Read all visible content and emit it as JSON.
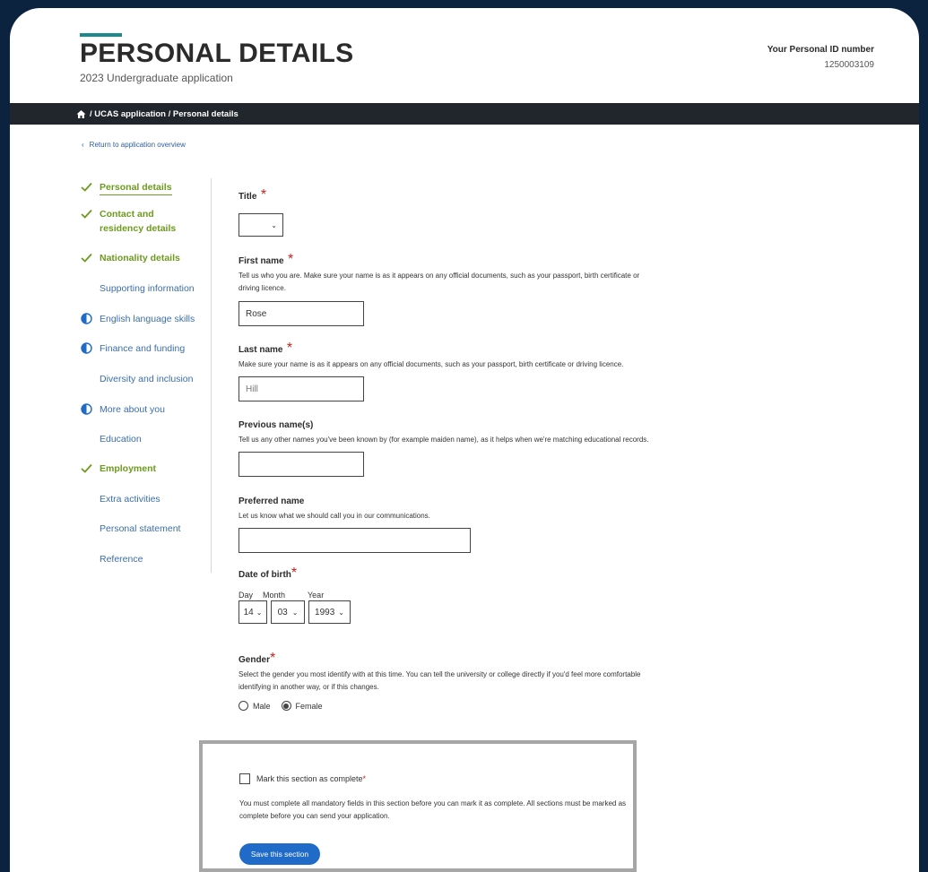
{
  "header": {
    "title": "PERSONAL DETAILS",
    "subtitle": "2023 Undergraduate application",
    "id_label": "Your Personal ID number",
    "id_value": "1250003109"
  },
  "breadcrumb": {
    "text": "/ UCAS application / Personal details"
  },
  "return_link": "Return to application overview",
  "sidebar": {
    "items": [
      {
        "label": "Personal details",
        "status": "done"
      },
      {
        "label": "Contact and residency details",
        "status": "done"
      },
      {
        "label": "Nationality details",
        "status": "done"
      },
      {
        "label": "Supporting information",
        "status": "none"
      },
      {
        "label": "English language skills",
        "status": "partial"
      },
      {
        "label": "Finance and funding",
        "status": "partial"
      },
      {
        "label": "Diversity and inclusion",
        "status": "none"
      },
      {
        "label": "More about you",
        "status": "partial"
      },
      {
        "label": "Education",
        "status": "none"
      },
      {
        "label": "Employment",
        "status": "done"
      },
      {
        "label": "Extra activities",
        "status": "none"
      },
      {
        "label": "Personal statement",
        "status": "none"
      },
      {
        "label": "Reference",
        "status": "none"
      }
    ]
  },
  "form": {
    "title": {
      "label": "Title",
      "req": "*",
      "value": ""
    },
    "first_name": {
      "label": "First name",
      "req": "*",
      "hint": "Tell us who you are. Make sure your name is as it appears on any official documents, such as your passport, birth certificate or driving licence.",
      "value": "Rose"
    },
    "last_name": {
      "label": "Last name",
      "req": "*",
      "hint": "Make sure your name is as it appears on any official documents, such as your passport, birth certificate or driving licence.",
      "value": "Hill"
    },
    "previous_name": {
      "label": "Previous name(s)",
      "hint": "Tell us any other names you've been known by (for example maiden name), as it helps when we're matching educational records.",
      "value": ""
    },
    "preferred_name": {
      "label": "Preferred name",
      "hint": "Let us know what we should call you in our communications.",
      "value": ""
    },
    "dob": {
      "label": "Date of birth",
      "req": "*",
      "day_label": "Day",
      "month_label": "Month",
      "year_label": "Year",
      "day": "14",
      "month": "03",
      "year": "1993"
    },
    "gender": {
      "label": "Gender",
      "req": "*",
      "hint": "Select the gender you most identify with at this time. You can tell the university or college directly if you'd feel more comfortable identifying in another way, or if this changes.",
      "options": [
        "Male",
        "Female"
      ],
      "selected": "Female"
    }
  },
  "complete": {
    "label": "Mark this section as complete",
    "req": "*",
    "hint": "You must complete all mandatory fields in this section before you can mark it as complete. All sections must be marked as complete before you can send your application.",
    "button": "Save this section"
  },
  "colors": {
    "done": "#6d9a1e",
    "link": "#3b6ea8",
    "accent": "#1f6bc7",
    "dark": "#21262d"
  }
}
